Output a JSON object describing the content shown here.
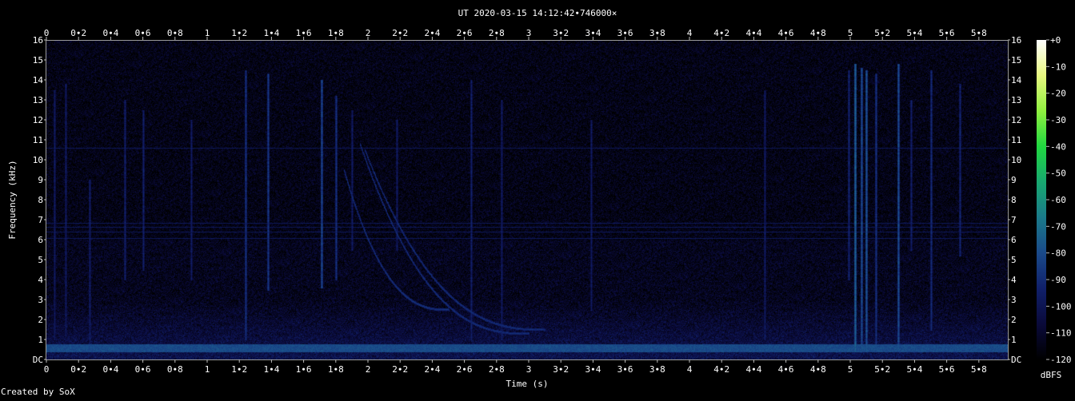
{
  "chart_data": {
    "type": "heatmap",
    "title": "UT 2020-03-15 14:12:42∙746000×",
    "xlabel": "Time (s)",
    "ylabel": "Frequency (kHz)",
    "xlim": [
      0,
      5.98
    ],
    "ylim": [
      0,
      16
    ],
    "x_ticks": [
      "0",
      "0∙2",
      "0∙4",
      "0∙6",
      "0∙8",
      "1",
      "1∙2",
      "1∙4",
      "1∙6",
      "1∙8",
      "2",
      "2∙2",
      "2∙4",
      "2∙6",
      "2∙8",
      "3",
      "3∙2",
      "3∙4",
      "3∙6",
      "3∙8",
      "4",
      "4∙2",
      "4∙4",
      "4∙6",
      "4∙8",
      "5",
      "5∙2",
      "5∙4",
      "5∙6",
      "5∙8"
    ],
    "y_ticks": [
      "DC",
      "1",
      "2",
      "3",
      "4",
      "5",
      "6",
      "7",
      "8",
      "9",
      "10",
      "11",
      "12",
      "13",
      "14",
      "15",
      "16"
    ],
    "colorbar": {
      "label": "dBFS",
      "ticks": [
        "+0",
        "-10",
        "-20",
        "-30",
        "-40",
        "-50",
        "-60",
        "-70",
        "-80",
        "-90",
        "-100",
        "-110",
        "-120"
      ],
      "range": [
        -120,
        0
      ],
      "colors": [
        "#000000",
        "#0a0a3a",
        "#10206a",
        "#1a4a8a",
        "#1a7a8a",
        "#18a870",
        "#20d840",
        "#90f040",
        "#e8f880",
        "#ffffff"
      ]
    },
    "features": {
      "background_level_dbfs": -110,
      "low_band_khz": [
        0.4,
        0.75
      ],
      "low_band_dbfs": -80,
      "horizontal_lines_khz": [
        10.6,
        6.1,
        6.4,
        6.65,
        6.85
      ],
      "impulses": [
        {
          "t": 0.05,
          "f_low": 1.0,
          "f_high": 13.5,
          "dbfs": -96
        },
        {
          "t": 0.12,
          "f_low": 1.2,
          "f_high": 13.8,
          "dbfs": -96
        },
        {
          "t": 0.27,
          "f_low": 0.5,
          "f_high": 9.0,
          "dbfs": -95
        },
        {
          "t": 0.49,
          "f_low": 4.0,
          "f_high": 13.0,
          "dbfs": -94
        },
        {
          "t": 0.6,
          "f_low": 4.5,
          "f_high": 12.5,
          "dbfs": -94
        },
        {
          "t": 0.9,
          "f_low": 4.0,
          "f_high": 12.0,
          "dbfs": -96
        },
        {
          "t": 1.24,
          "f_low": 1.0,
          "f_high": 14.5,
          "dbfs": -88
        },
        {
          "t": 1.38,
          "f_low": 3.5,
          "f_high": 14.3,
          "dbfs": -86
        },
        {
          "t": 1.71,
          "f_low": 3.6,
          "f_high": 14.0,
          "dbfs": -82
        },
        {
          "t": 1.8,
          "f_low": 4.0,
          "f_high": 13.2,
          "dbfs": -88
        },
        {
          "t": 1.9,
          "f_low": 5.5,
          "f_high": 12.5,
          "dbfs": -96
        },
        {
          "t": 2.18,
          "f_low": 5.5,
          "f_high": 12.0,
          "dbfs": -96
        },
        {
          "t": 2.64,
          "f_low": 1.0,
          "f_high": 14.0,
          "dbfs": -94
        },
        {
          "t": 2.83,
          "f_low": 1.0,
          "f_high": 13.0,
          "dbfs": -96
        },
        {
          "t": 3.39,
          "f_low": 2.5,
          "f_high": 12.0,
          "dbfs": -96
        },
        {
          "t": 4.47,
          "f_low": 1.0,
          "f_high": 13.5,
          "dbfs": -96
        },
        {
          "t": 4.99,
          "f_low": 4.0,
          "f_high": 14.5,
          "dbfs": -92
        },
        {
          "t": 5.03,
          "f_low": 0.4,
          "f_high": 14.8,
          "dbfs": -74
        },
        {
          "t": 5.07,
          "f_low": 0.4,
          "f_high": 14.6,
          "dbfs": -80
        },
        {
          "t": 5.1,
          "f_low": 0.4,
          "f_high": 14.5,
          "dbfs": -78
        },
        {
          "t": 5.16,
          "f_low": 0.8,
          "f_high": 14.3,
          "dbfs": -88
        },
        {
          "t": 5.3,
          "f_low": 0.4,
          "f_high": 14.8,
          "dbfs": -80
        },
        {
          "t": 5.38,
          "f_low": 5.5,
          "f_high": 13.0,
          "dbfs": -94
        },
        {
          "t": 5.5,
          "f_low": 1.5,
          "f_high": 14.5,
          "dbfs": -90
        },
        {
          "t": 5.68,
          "f_low": 5.2,
          "f_high": 13.8,
          "dbfs": -92
        }
      ],
      "dispersed_sweeps": [
        {
          "t_start": 1.95,
          "t_end": 3.0,
          "f_start_khz": 10.8,
          "f_end_khz": 1.3
        },
        {
          "t_start": 1.98,
          "t_end": 3.1,
          "f_start_khz": 10.5,
          "f_end_khz": 1.5
        },
        {
          "t_start": 1.85,
          "t_end": 2.5,
          "f_start_khz": 9.5,
          "f_end_khz": 2.5
        }
      ]
    }
  },
  "footer": {
    "credit": "Created by SoX"
  }
}
